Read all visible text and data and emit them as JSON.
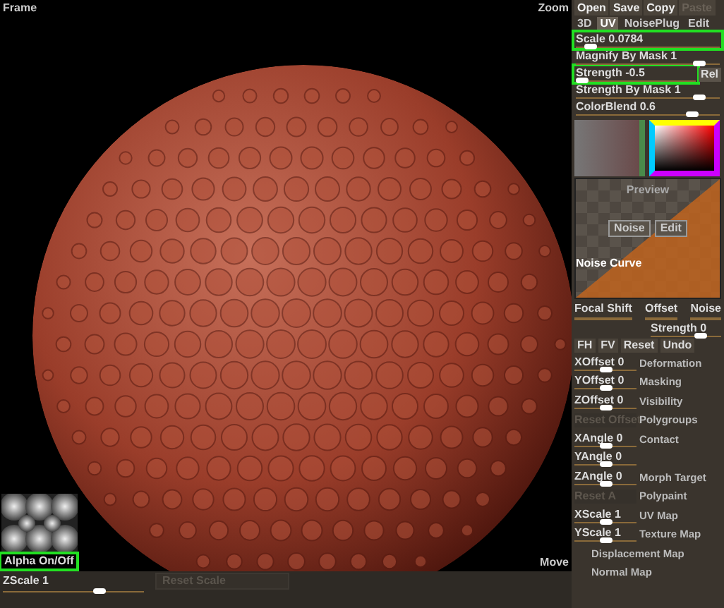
{
  "viewport": {
    "frame_label": "Frame",
    "zoom_label": "Zoom",
    "move_label": "Move",
    "alpha_toggle": {
      "label": "Alpha On/Off",
      "highlighted": true
    }
  },
  "bottom_bar": {
    "zscale": {
      "label": "ZScale",
      "value": "1",
      "level": 0.68
    },
    "reset_button": {
      "label": "Reset Scale",
      "disabled": true
    }
  },
  "panel": {
    "file_buttons": [
      {
        "label": "Open",
        "disabled": false
      },
      {
        "label": "Save",
        "disabled": false
      },
      {
        "label": "Copy",
        "disabled": false
      },
      {
        "label": "Paste",
        "disabled": true
      }
    ],
    "tabs": [
      {
        "label": "3D",
        "selected": false
      },
      {
        "label": "UV",
        "selected": true
      },
      {
        "label": "NoisePlug",
        "selected": false
      },
      {
        "label": "Edit",
        "selected": false
      }
    ],
    "settings": [
      {
        "label": "Scale",
        "value": "0.0784",
        "level": 0.1,
        "highlighted": true
      },
      {
        "label": "Magnify By Mask",
        "value": "1",
        "level": 0.85,
        "highlighted": false
      },
      {
        "label": "Strength",
        "value": "-0.5",
        "level": 0.05,
        "highlighted": true,
        "button": "Rel"
      },
      {
        "label": "Strength By Mask",
        "value": "1",
        "level": 0.85,
        "highlighted": false
      },
      {
        "label": "ColorBlend",
        "value": "0.6",
        "level": 0.8,
        "highlighted": false
      }
    ],
    "preview": {
      "title": "Preview",
      "buttons": [
        "Noise",
        "Edit"
      ],
      "curve_label": "Noise Curve"
    },
    "curve_controls": [
      {
        "label": "Focal Shift"
      },
      {
        "label": "Offset"
      },
      {
        "label": "Noise"
      }
    ],
    "curve_strength": {
      "label": "Strength",
      "value": "0",
      "level": 0.7
    },
    "edit_buttons": [
      "FH",
      "FV",
      "Reset",
      "Undo"
    ],
    "rows": [
      {
        "kind": "slider",
        "label": "XOffset",
        "value": "0",
        "level": 0.5,
        "menu": "Deformation"
      },
      {
        "kind": "slider",
        "label": "YOffset",
        "value": "0",
        "level": 0.5,
        "menu": "Masking"
      },
      {
        "kind": "slider",
        "label": "ZOffset",
        "value": "0",
        "level": 0.5,
        "menu": "Visibility"
      },
      {
        "kind": "button",
        "label": "Reset Offset",
        "menu": "Polygroups"
      },
      {
        "kind": "slider",
        "label": "XAngle",
        "value": "0",
        "level": 0.5,
        "menu": "Contact"
      },
      {
        "kind": "slider",
        "label": "YAngle",
        "value": "0",
        "level": 0.5
      },
      {
        "kind": "slider",
        "label": "ZAngle",
        "value": "0",
        "level": 0.5,
        "menu": "Morph Target"
      },
      {
        "kind": "button",
        "label": "Reset A",
        "menu": "Polypaint"
      },
      {
        "kind": "slider",
        "label": "XScale",
        "value": "1",
        "level": 0.5,
        "menu": "UV Map"
      },
      {
        "kind": "slider",
        "label": "YScale",
        "value": "1",
        "level": 0.5,
        "menu": "Texture Map"
      },
      {
        "kind": "menu",
        "menu": "Displacement Map"
      },
      {
        "kind": "menu",
        "menu": "Normal Map"
      }
    ]
  }
}
